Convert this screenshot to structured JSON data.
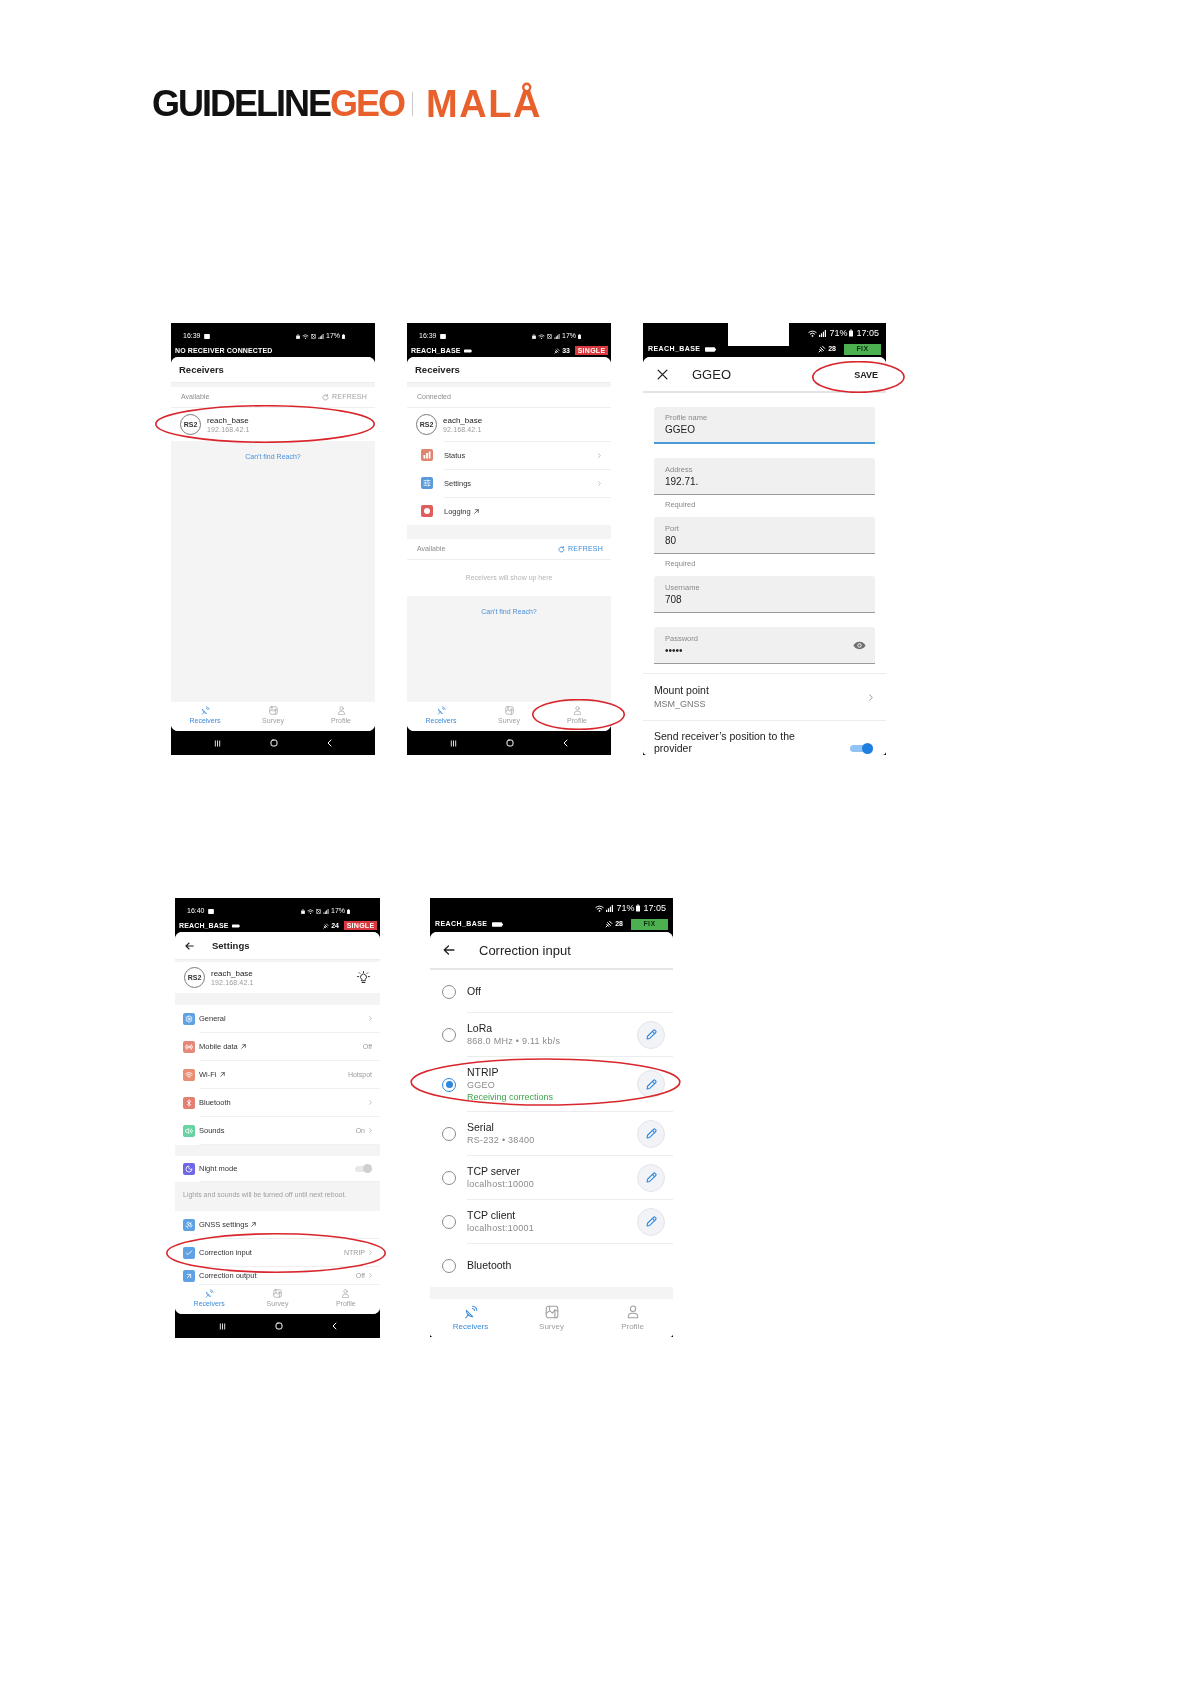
{
  "logo": {
    "primary": "GUIDELINE",
    "accent": "GEO",
    "product": "MALÅ"
  },
  "figure_rows": [
    {
      "screenshots": [
        {
          "kind": "receivers",
          "status_bar": {
            "kind": "split",
            "time": "16:39",
            "battery": "17%",
            "receiver": "NO RECEIVER CONNECTED",
            "connected": false
          },
          "app_bar": {
            "kind": "root",
            "title": "Receivers"
          },
          "sections": [
            {
              "heading": "Available",
              "action": {
                "label": "REFRESH",
                "disabled": true
              },
              "receivers": [
                {
                  "model": "RS2",
                  "name": "reach_base",
                  "address": "192.168.42.1",
                  "highlighted": true
                }
              ]
            }
          ],
          "link": "Can't find Reach?",
          "bottom_nav": [
            {
              "label": "Receivers",
              "selected": true,
              "highlighted": false
            },
            {
              "label": "Survey",
              "selected": false,
              "highlighted": false
            },
            {
              "label": "Profile",
              "selected": false,
              "highlighted": false
            }
          ],
          "system_nav_bar": true
        },
        {
          "kind": "receivers",
          "status_bar": {
            "kind": "split",
            "time": "16:39",
            "battery": "17%",
            "receiver": "REACH_BASE",
            "connected": true,
            "satellites": "33",
            "solution": {
              "label": "SINGLE",
              "color": "#d9393e"
            }
          },
          "app_bar": {
            "kind": "root",
            "title": "Receivers"
          },
          "sections": [
            {
              "heading": "Connected",
              "receivers": [
                {
                  "model": "RS2",
                  "name": "each_base",
                  "address": "92.168.42.1",
                  "highlighted": false
                }
              ],
              "menu": [
                {
                  "label": "Status",
                  "color": "#e0836f",
                  "external": false,
                  "chevron": true
                },
                {
                  "label": "Settings",
                  "color": "#5b9ad8",
                  "external": false,
                  "chevron": true
                },
                {
                  "label": "Logging",
                  "color": "#e05d5d",
                  "external": true,
                  "chevron": false
                }
              ]
            },
            {
              "heading": "Available",
              "action": {
                "label": "REFRESH",
                "disabled": false
              },
              "empty_text": "Receivers will show up here"
            }
          ],
          "link": "Can't find Reach?",
          "bottom_nav": [
            {
              "label": "Receivers",
              "selected": true,
              "highlighted": false
            },
            {
              "label": "Survey",
              "selected": false,
              "highlighted": false
            },
            {
              "label": "Profile",
              "selected": false,
              "highlighted": true
            }
          ],
          "system_nav_bar": true
        },
        {
          "kind": "form",
          "status_bar": {
            "kind": "right",
            "time": "17:05",
            "battery": "71%",
            "receiver": "REACH_BASE",
            "connected": true,
            "satellites": "28",
            "solution": {
              "label": "FIX",
              "color": "#4caf50"
            },
            "redacted": true
          },
          "app_bar": {
            "kind": "dialog",
            "title": "GGEO",
            "action": {
              "label": "SAVE",
              "highlighted": true
            }
          },
          "fields": [
            {
              "kind": "text",
              "label": "Profile name",
              "value": "GGEO",
              "focused": true
            },
            {
              "kind": "text",
              "label": "Address",
              "value": "192.71.",
              "helper": "Required",
              "focused": false
            },
            {
              "kind": "text",
              "label": "Port",
              "value": "80",
              "helper": "Required",
              "focused": false
            },
            {
              "kind": "text",
              "label": "Username",
              "value": "708",
              "focused": false
            },
            {
              "kind": "password",
              "label": "Password",
              "value": "•••••",
              "focused": false
            }
          ],
          "rows": [
            {
              "kind": "link",
              "label": "Mount point",
              "value": "MSM_GNSS"
            },
            {
              "kind": "toggle",
              "label": "Send receiver’s position to the provider",
              "on": true
            }
          ]
        }
      ]
    },
    {
      "screenshots": [
        {
          "kind": "settings",
          "status_bar": {
            "kind": "split",
            "time": "16:40",
            "battery": "17%",
            "receiver": "REACH_BASE",
            "connected": true,
            "satellites": "24",
            "solution": {
              "label": "SINGLE",
              "color": "#d9393e"
            }
          },
          "app_bar": {
            "kind": "back",
            "title": "Settings"
          },
          "receiver": {
            "model": "RS2",
            "name": "reach_base",
            "address": "192.168.42.1"
          },
          "groups": [
            {
              "items": [
                {
                  "kind": "link",
                  "label": "General",
                  "color": "#5fa2e4",
                  "external": false,
                  "chevron": true,
                  "highlighted": false
                },
                {
                  "kind": "link",
                  "label": "Mobile data",
                  "color": "#e5887a",
                  "external": true,
                  "value": "Off",
                  "chevron": false,
                  "highlighted": false
                },
                {
                  "kind": "link",
                  "label": "Wi-Fi",
                  "color": "#e98d73",
                  "external": true,
                  "value": "Hotspot",
                  "chevron": false,
                  "highlighted": false
                },
                {
                  "kind": "link",
                  "label": "Bluetooth",
                  "color": "#e27f70",
                  "external": false,
                  "chevron": true,
                  "highlighted": false
                },
                {
                  "kind": "link",
                  "label": "Sounds",
                  "color": "#66d3a3",
                  "external": false,
                  "value": "On",
                  "chevron": true,
                  "highlighted": false
                }
              ]
            },
            {
              "items": [
                {
                  "kind": "toggle",
                  "label": "Night mode",
                  "color": "#6f66e6",
                  "on": false,
                  "external": false,
                  "highlighted": false
                }
              ],
              "note": "Lights and sounds will be turned off until next reboot."
            },
            {
              "items": [
                {
                  "kind": "link",
                  "label": "GNSS settings",
                  "color": "#5fa2e4",
                  "external": true,
                  "chevron": false,
                  "highlighted": false
                },
                {
                  "kind": "link",
                  "label": "Correction input",
                  "color": "#5fa2e4",
                  "external": false,
                  "value": "NTRIP",
                  "chevron": true,
                  "highlighted": true
                },
                {
                  "kind": "link",
                  "label": "Correction output",
                  "color": "#5fa2e4",
                  "external": false,
                  "value": "Off",
                  "chevron": true,
                  "highlighted": false
                }
              ]
            }
          ],
          "bottom_nav": [
            {
              "label": "Receivers",
              "selected": true,
              "highlighted": false
            },
            {
              "label": "Survey",
              "selected": false,
              "highlighted": false
            },
            {
              "label": "Profile",
              "selected": false,
              "highlighted": false
            }
          ],
          "system_nav_bar": true
        },
        {
          "kind": "radio_list",
          "status_bar": {
            "kind": "right",
            "time": "17:05",
            "battery": "71%",
            "receiver": "REACH_BASE",
            "connected": true,
            "satellites": "28",
            "solution": {
              "label": "FIX",
              "color": "#4caf50"
            }
          },
          "app_bar": {
            "kind": "back",
            "title": "Correction input"
          },
          "options": [
            {
              "label": "Off",
              "selected": false,
              "editable": false,
              "highlighted": false
            },
            {
              "label": "LoRa",
              "details": "868.0 MHz • 9.11 kb/s",
              "selected": false,
              "editable": true,
              "highlighted": false
            },
            {
              "label": "NTRIP",
              "details": "GGEO",
              "status": "Receiving corrections",
              "selected": true,
              "editable": true,
              "highlighted": true
            },
            {
              "label": "Serial",
              "details": "RS-232 • 38400",
              "selected": false,
              "editable": true,
              "highlighted": false
            },
            {
              "label": "TCP server",
              "details": "localhost:10000",
              "selected": false,
              "editable": true,
              "highlighted": false
            },
            {
              "label": "TCP client",
              "details": "localhost:10001",
              "selected": false,
              "editable": true,
              "highlighted": false
            },
            {
              "label": "Bluetooth",
              "selected": false,
              "editable": false,
              "highlighted": false
            }
          ],
          "bottom_nav": [
            {
              "label": "Receivers",
              "selected": true,
              "highlighted": false
            },
            {
              "label": "Survey",
              "selected": false,
              "highlighted": false
            },
            {
              "label": "Profile",
              "selected": false,
              "highlighted": false
            }
          ]
        }
      ]
    }
  ]
}
